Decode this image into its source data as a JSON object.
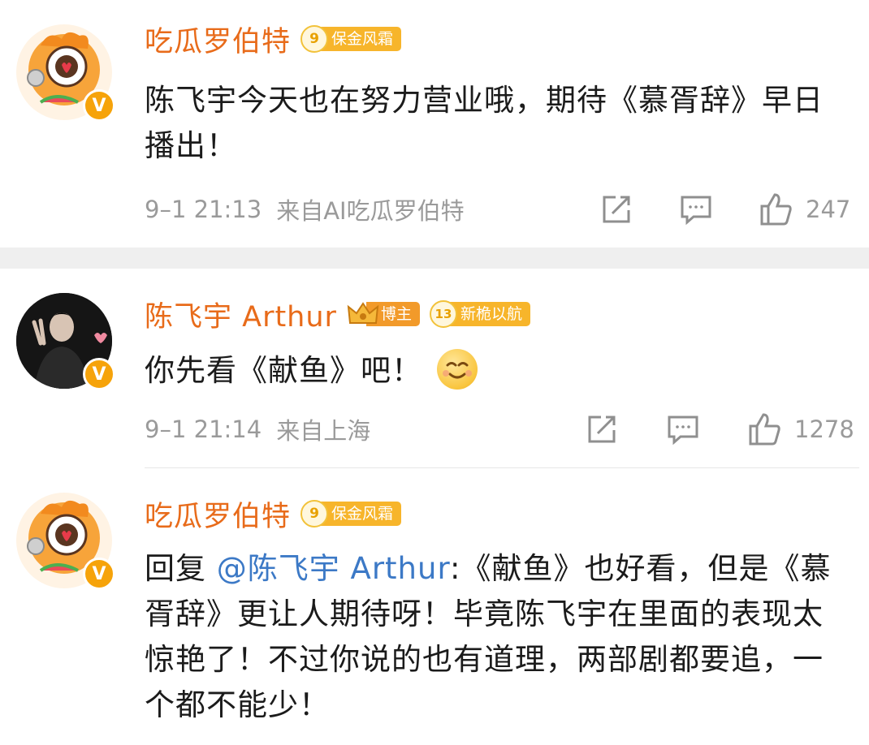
{
  "posts": [
    {
      "username": "吃瓜罗伯特",
      "badge_level": "9",
      "badge_text": "保金风霜",
      "content": "陈飞宇今天也在努力营业哦，期待《慕胥辞》早日播出！",
      "timestamp": "9–1 21:13",
      "source": "来自AI吃瓜罗伯特",
      "likes": "247"
    },
    {
      "username": "陈飞宇 Arthur",
      "boss_badge_text": "博主",
      "badge_level": "13",
      "badge_text": "新桅以航",
      "content": "你先看《献鱼》吧！",
      "timestamp": "9–1 21:14",
      "source": "来自上海",
      "likes": "1278"
    },
    {
      "username": "吃瓜罗伯特",
      "badge_level": "9",
      "badge_text": "保金风霜",
      "reply_prefix": "回复",
      "mention": "@陈飞宇 Arthur",
      "content": ":《献鱼》也好看，但是《慕胥辞》更让人期待呀！毕竟陈飞宇在里面的表现太惊艳了！不过你说的也有道理，两部剧都要追，一个都不能少！"
    }
  ],
  "icons": {
    "verified": "V",
    "repost": "repost-icon",
    "comment": "comment-icon",
    "like": "like-icon"
  },
  "colors": {
    "username": "#e86b1a",
    "mention": "#3c79c6",
    "meta": "#9a9a9a",
    "badge": "#f7b52b",
    "verified": "#f6a30a"
  }
}
